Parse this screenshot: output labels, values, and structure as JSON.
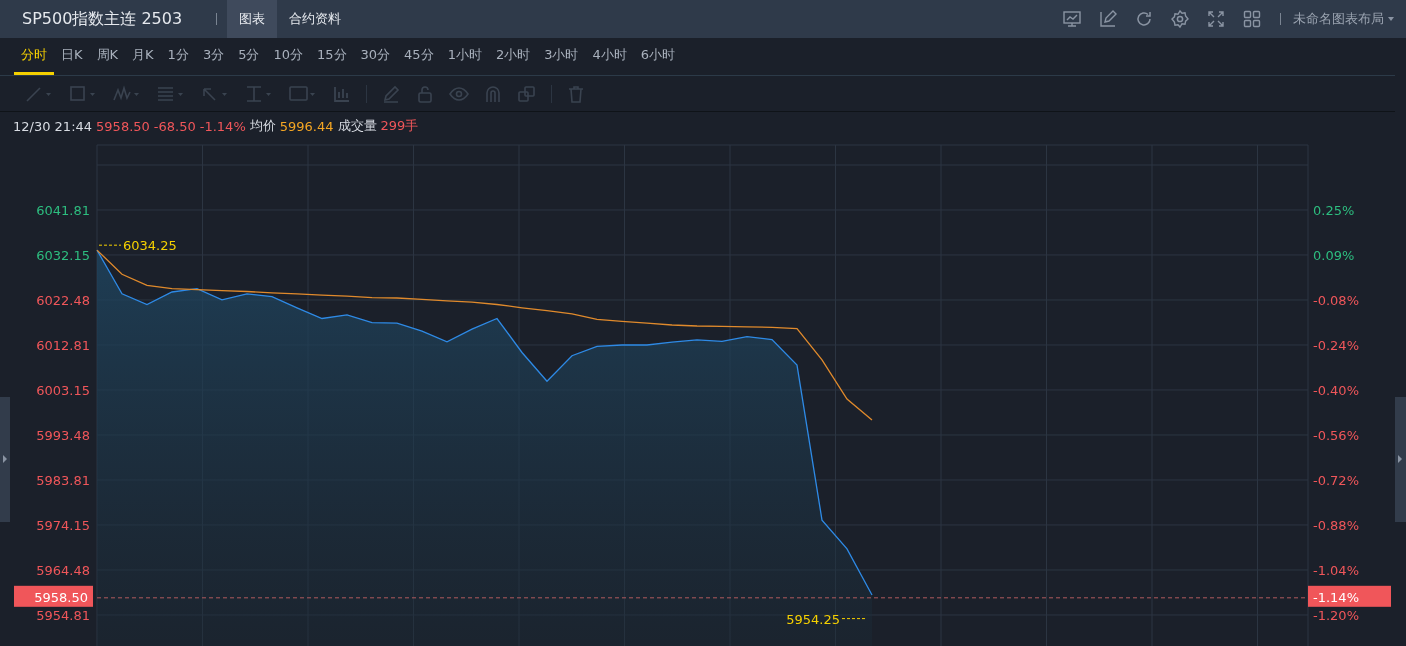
{
  "header": {
    "title": "SP500指数主连 2503",
    "tabs": [
      {
        "label": "图表",
        "selected": true
      },
      {
        "label": "合约资料",
        "selected": false
      }
    ],
    "layout_menu": "未命名图表布局"
  },
  "periods": [
    {
      "label": "分时",
      "selected": true
    },
    {
      "label": "日K",
      "selected": false
    },
    {
      "label": "周K",
      "selected": false
    },
    {
      "label": "月K",
      "selected": false
    },
    {
      "label": "1分",
      "selected": false
    },
    {
      "label": "3分",
      "selected": false
    },
    {
      "label": "5分",
      "selected": false
    },
    {
      "label": "10分",
      "selected": false
    },
    {
      "label": "15分",
      "selected": false
    },
    {
      "label": "30分",
      "selected": false
    },
    {
      "label": "45分",
      "selected": false
    },
    {
      "label": "1小时",
      "selected": false
    },
    {
      "label": "2小时",
      "selected": false
    },
    {
      "label": "3小时",
      "selected": false
    },
    {
      "label": "4小时",
      "selected": false
    },
    {
      "label": "6小时",
      "selected": false
    }
  ],
  "info": [
    {
      "text": "12/30 21:44",
      "kind": "label"
    },
    {
      "text": "5958.50",
      "kind": "down"
    },
    {
      "text": "-68.50",
      "kind": "down"
    },
    {
      "text": "-1.14%",
      "kind": "down"
    },
    {
      "text": "均价",
      "kind": "label"
    },
    {
      "text": "5996.44",
      "kind": "avg"
    },
    {
      "text": "成交量",
      "kind": "label"
    },
    {
      "text": "299手",
      "kind": "down"
    }
  ],
  "chart": {
    "high_label": "6034.25",
    "low_label": "5954.25",
    "last_price_tag": "5958.50",
    "last_change_tag": "-1.14%",
    "right_ticks": [
      {
        "label": "0.25%",
        "color": "#2dbd7f"
      },
      {
        "label": "0.09%",
        "color": "#2dbd7f"
      },
      {
        "label": "-0.08%",
        "color": "#f0565a"
      },
      {
        "label": "-0.24%",
        "color": "#f0565a"
      },
      {
        "label": "-0.40%",
        "color": "#f0565a"
      },
      {
        "label": "-0.56%",
        "color": "#f0565a"
      },
      {
        "label": "-0.72%",
        "color": "#f0565a"
      },
      {
        "label": "-0.88%",
        "color": "#f0565a"
      },
      {
        "label": "-1.04%",
        "color": "#f0565a"
      },
      {
        "label": "-1.20%",
        "color": "#f0565a"
      }
    ],
    "chart_data": {
      "type": "area",
      "grid": true,
      "ylim": [
        5948.15,
        6055.77
      ],
      "yticks": [
        {
          "value": 6041.81,
          "label": "6041.81"
        },
        {
          "value": 6032.15,
          "label": "6032.15"
        },
        {
          "value": 6022.48,
          "label": "6022.48"
        },
        {
          "value": 6012.81,
          "label": "6012.81"
        },
        {
          "value": 6003.15,
          "label": "6003.15"
        },
        {
          "value": 5993.48,
          "label": "5993.48"
        },
        {
          "value": 5983.81,
          "label": "5983.81"
        },
        {
          "value": 5974.15,
          "label": "5974.15"
        },
        {
          "value": 5964.48,
          "label": "5964.48"
        },
        {
          "value": 5954.81,
          "label": "5954.81"
        }
      ],
      "categories": [
        null,
        null,
        null,
        null,
        null,
        null,
        null,
        null,
        null,
        null,
        null,
        null,
        null,
        null,
        null,
        null,
        null,
        null,
        null,
        null,
        null,
        null,
        null,
        null,
        null,
        null,
        null,
        null,
        null,
        null,
        null,
        null
      ],
      "series": [
        {
          "color": "#2e8ae6",
          "values": [
            6033.2,
            6023.8,
            6021.5,
            6024.2,
            6024.9,
            6022.5,
            6023.8,
            6023.2,
            6020.8,
            6018.5,
            6019.3,
            6017.6,
            6017.5,
            6015.8,
            6013.5,
            6016.2,
            6018.5,
            6011.2,
            6005.0,
            6010.5,
            6012.5,
            6012.8,
            6012.8,
            6013.4,
            6013.9,
            6013.6,
            6014.6,
            6014.0,
            6008.5,
            5975.2,
            5969.0,
            5959.1
          ]
        },
        {
          "type": "line",
          "color": "#e08a2c",
          "values": [
            6033.2,
            6028.0,
            6025.6,
            6024.9,
            6024.7,
            6024.5,
            6024.3,
            6024.0,
            6023.8,
            6023.5,
            6023.3,
            6023.0,
            6022.9,
            6022.6,
            6022.3,
            6022.0,
            6021.5,
            6020.8,
            6020.2,
            6019.5,
            6018.3,
            6017.9,
            6017.5,
            6017.1,
            6016.9,
            6016.8,
            6016.7,
            6016.6,
            6016.3,
            6009.6,
            6001.2,
            5996.7
          ]
        }
      ]
    }
  }
}
